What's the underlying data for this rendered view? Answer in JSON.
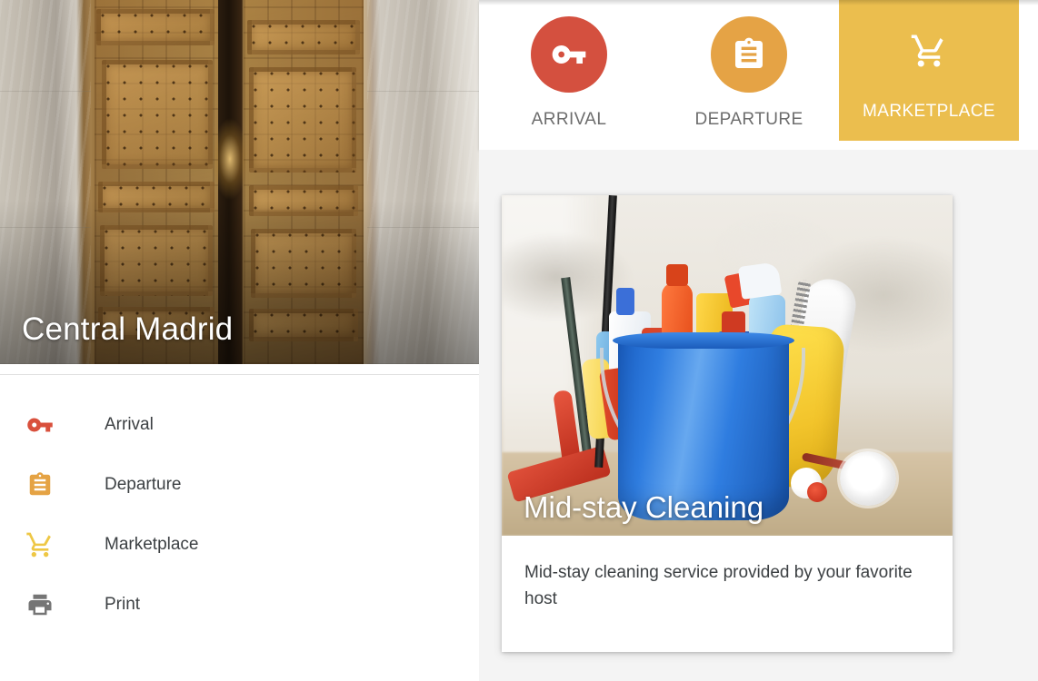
{
  "property": {
    "hero_title": "Central Madrid",
    "hero_image_alt": "ornate-wooden-double-doors"
  },
  "sidebar": {
    "items": [
      {
        "label": "Arrival",
        "icon": "key-icon",
        "color": "#d9503c"
      },
      {
        "label": "Departure",
        "icon": "clipboard-icon",
        "color": "#e5a344"
      },
      {
        "label": "Marketplace",
        "icon": "cart-icon",
        "color": "#eec745"
      },
      {
        "label": "Print",
        "icon": "printer-icon",
        "color": "#757575"
      }
    ]
  },
  "tabs": [
    {
      "label": "ARRIVAL",
      "icon": "key-icon",
      "bubble_color": "#d4503f",
      "active": false
    },
    {
      "label": "DEPARTURE",
      "icon": "clipboard-icon",
      "bubble_color": "#e5a345",
      "active": false
    },
    {
      "label": "MARKETPLACE",
      "icon": "cart-icon",
      "bubble_color": "#ebbe4e",
      "active": true
    }
  ],
  "marketplace": {
    "cards": [
      {
        "title": "Mid-stay Cleaning",
        "description": "Mid-stay cleaning service provided by your favorite host",
        "image_alt": "blue-bucket-with-cleaning-supplies"
      }
    ]
  },
  "colors": {
    "arrival_red": "#d4503f",
    "departure_orange": "#e5a345",
    "marketplace_yellow": "#ebbe4e",
    "page_background": "#f4f4f4",
    "panel_background": "#ffffff",
    "text_primary": "#3c4043",
    "text_muted": "#6d6d6d"
  }
}
